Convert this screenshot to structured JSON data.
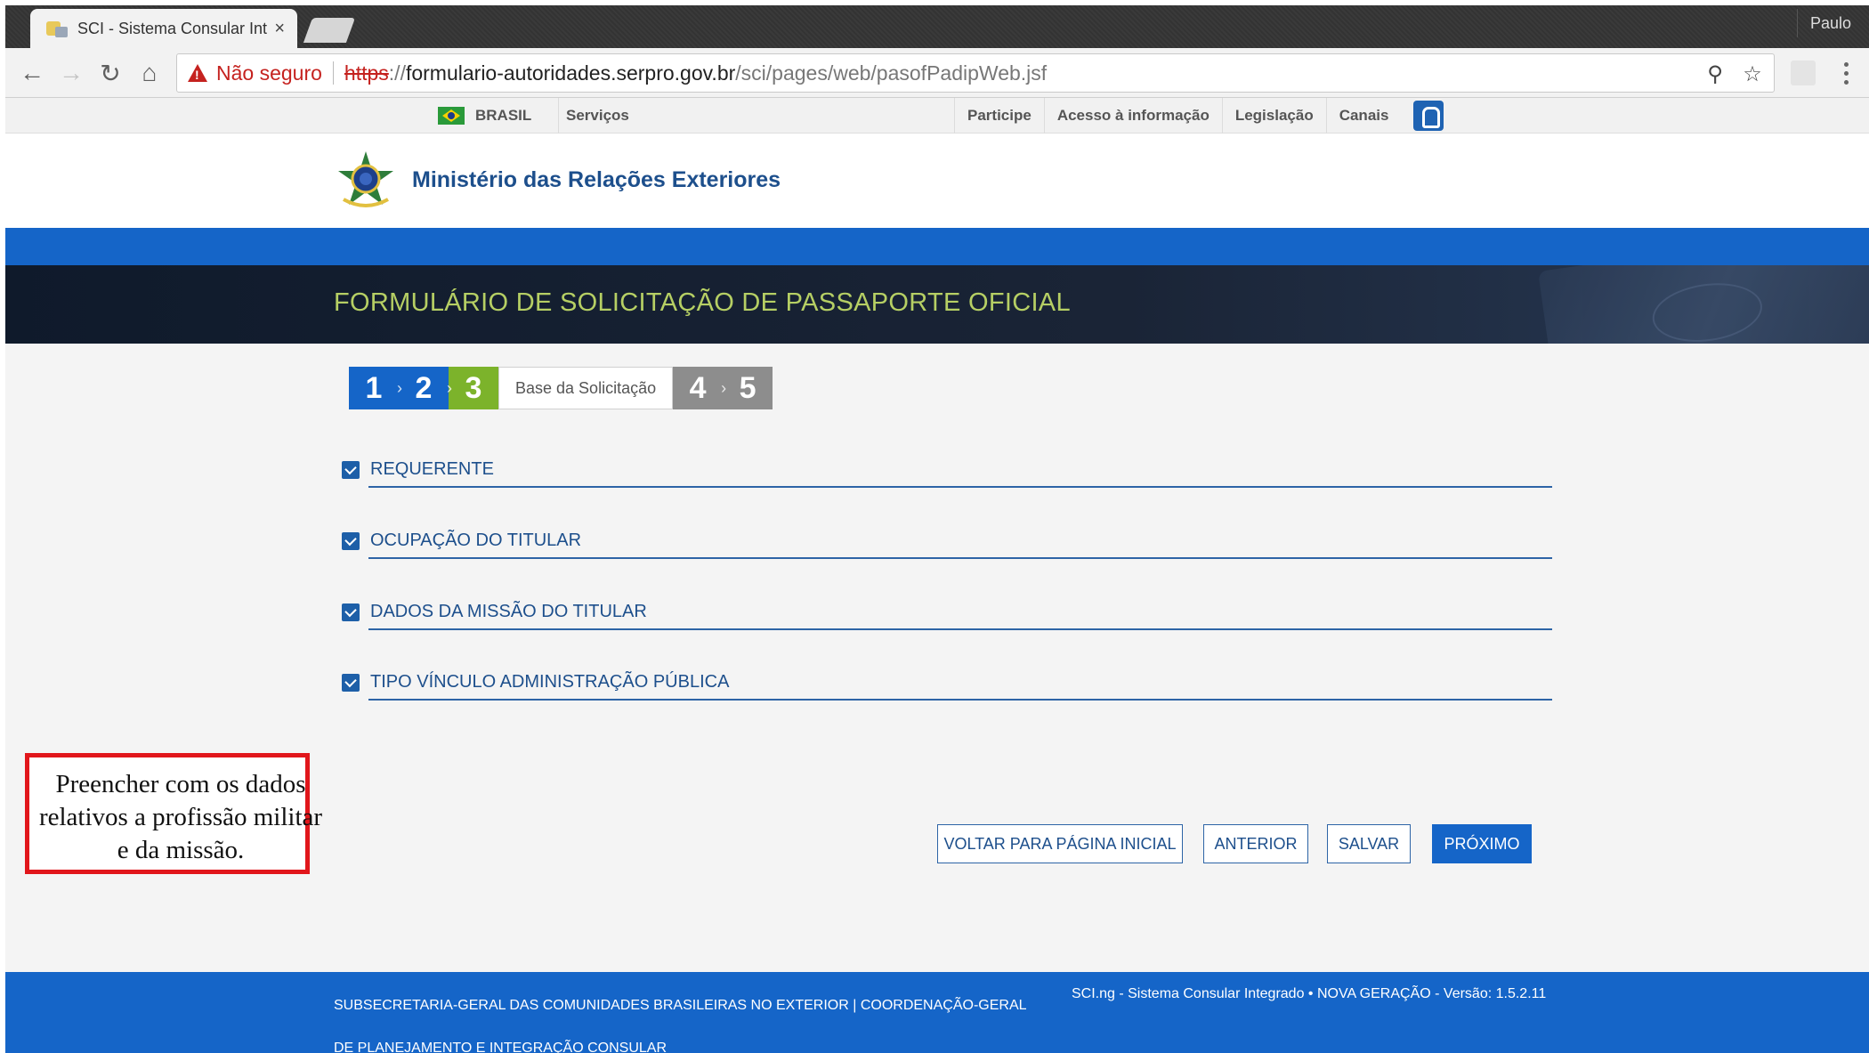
{
  "browser": {
    "tab_title": "SCI - Sistema Consular Inte",
    "tab_close": "×",
    "profile_name": "Paulo",
    "security_label": "Não seguro",
    "url": {
      "scheme": "https",
      "host": "formulario-autoridades.serpro.gov.br",
      "path": "/sci/pages/web/pasofPadipWeb.jsf"
    },
    "icons": [
      "back-icon",
      "forward-icon",
      "reload-icon",
      "home-icon",
      "warning-icon",
      "zoom-icon",
      "star-icon",
      "extension-icon",
      "menu-icon"
    ]
  },
  "govbar": {
    "brasil_label": "BRASIL",
    "servicos_label": "Serviços",
    "links": [
      "Participe",
      "Acesso à informação",
      "Legislação",
      "Canais"
    ]
  },
  "header": {
    "ministry_title": "Ministério das Relações Exteriores"
  },
  "banner": {
    "title": "FORMULÁRIO DE SOLICITAÇÃO DE PASSAPORTE OFICIAL"
  },
  "steps": {
    "items": [
      "1",
      "2",
      "3",
      "4",
      "5"
    ],
    "current": 3,
    "current_label": "Base da Solicitação"
  },
  "sections": [
    "REQUERENTE",
    "OCUPAÇÃO DO TITULAR",
    "DADOS DA MISSÃO DO TITULAR",
    "TIPO VÍNCULO ADMINISTRAÇÃO PÚBLICA"
  ],
  "annotation": {
    "text": "Preencher com os dados relativos a profissão militar e da missão."
  },
  "buttons": {
    "voltar": "VOLTAR PARA PÁGINA INICIAL",
    "anterior": "ANTERIOR",
    "salvar": "SALVAR",
    "proximo": "PRÓXIMO"
  },
  "footer": {
    "left": "SUBSECRETARIA-GERAL DAS COMUNIDADES BRASILEIRAS NO EXTERIOR | COORDENAÇÃO-GERAL DE PLANEJAMENTO E INTEGRAÇÃO CONSULAR",
    "right": "SCI.ng - Sistema Consular Integrado • NOVA GERAÇÃO - Versão: 1.5.2.11"
  },
  "colors": {
    "primary_blue": "#1565c8",
    "banner_title": "#b6cf64",
    "step_current": "#7cb32b",
    "step_pending": "#8d8d8d",
    "annotation_border": "#e1161b",
    "insecure_red": "#c5221f"
  }
}
